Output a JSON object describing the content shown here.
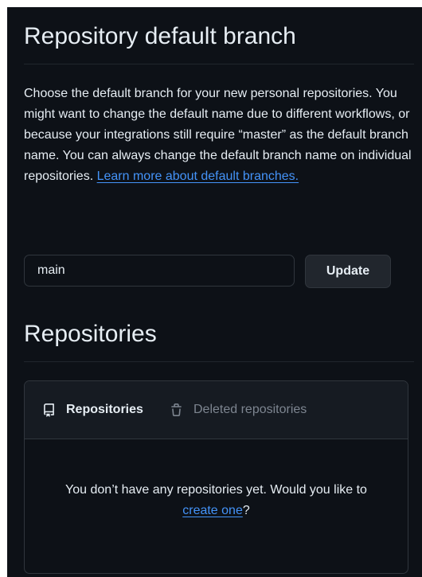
{
  "default_branch": {
    "title": "Repository default branch",
    "description": "Choose the default branch for your new personal repositories. You might want to change the default name due to different workflows, or because your integrations still require “master” as the default branch name. You can always change the default branch name on individual repositories.",
    "learn_more_link": "Learn more about default branches.",
    "input_value": "main",
    "update_button": "Update"
  },
  "repositories": {
    "title": "Repositories",
    "tabs": [
      {
        "label": "Repositories",
        "icon": "repo-icon",
        "selected": true
      },
      {
        "label": "Deleted repositories",
        "icon": "trash-icon",
        "selected": false
      }
    ],
    "empty_text_before": "You don’t have any repositories yet. Would you like to",
    "create_link": "create one",
    "empty_text_after": "?"
  },
  "colors": {
    "background": "#0d1117",
    "text": "#e6edf3",
    "muted": "#7d8590",
    "link": "#4493f8",
    "border": "#30363d",
    "button_bg": "#21262d"
  }
}
